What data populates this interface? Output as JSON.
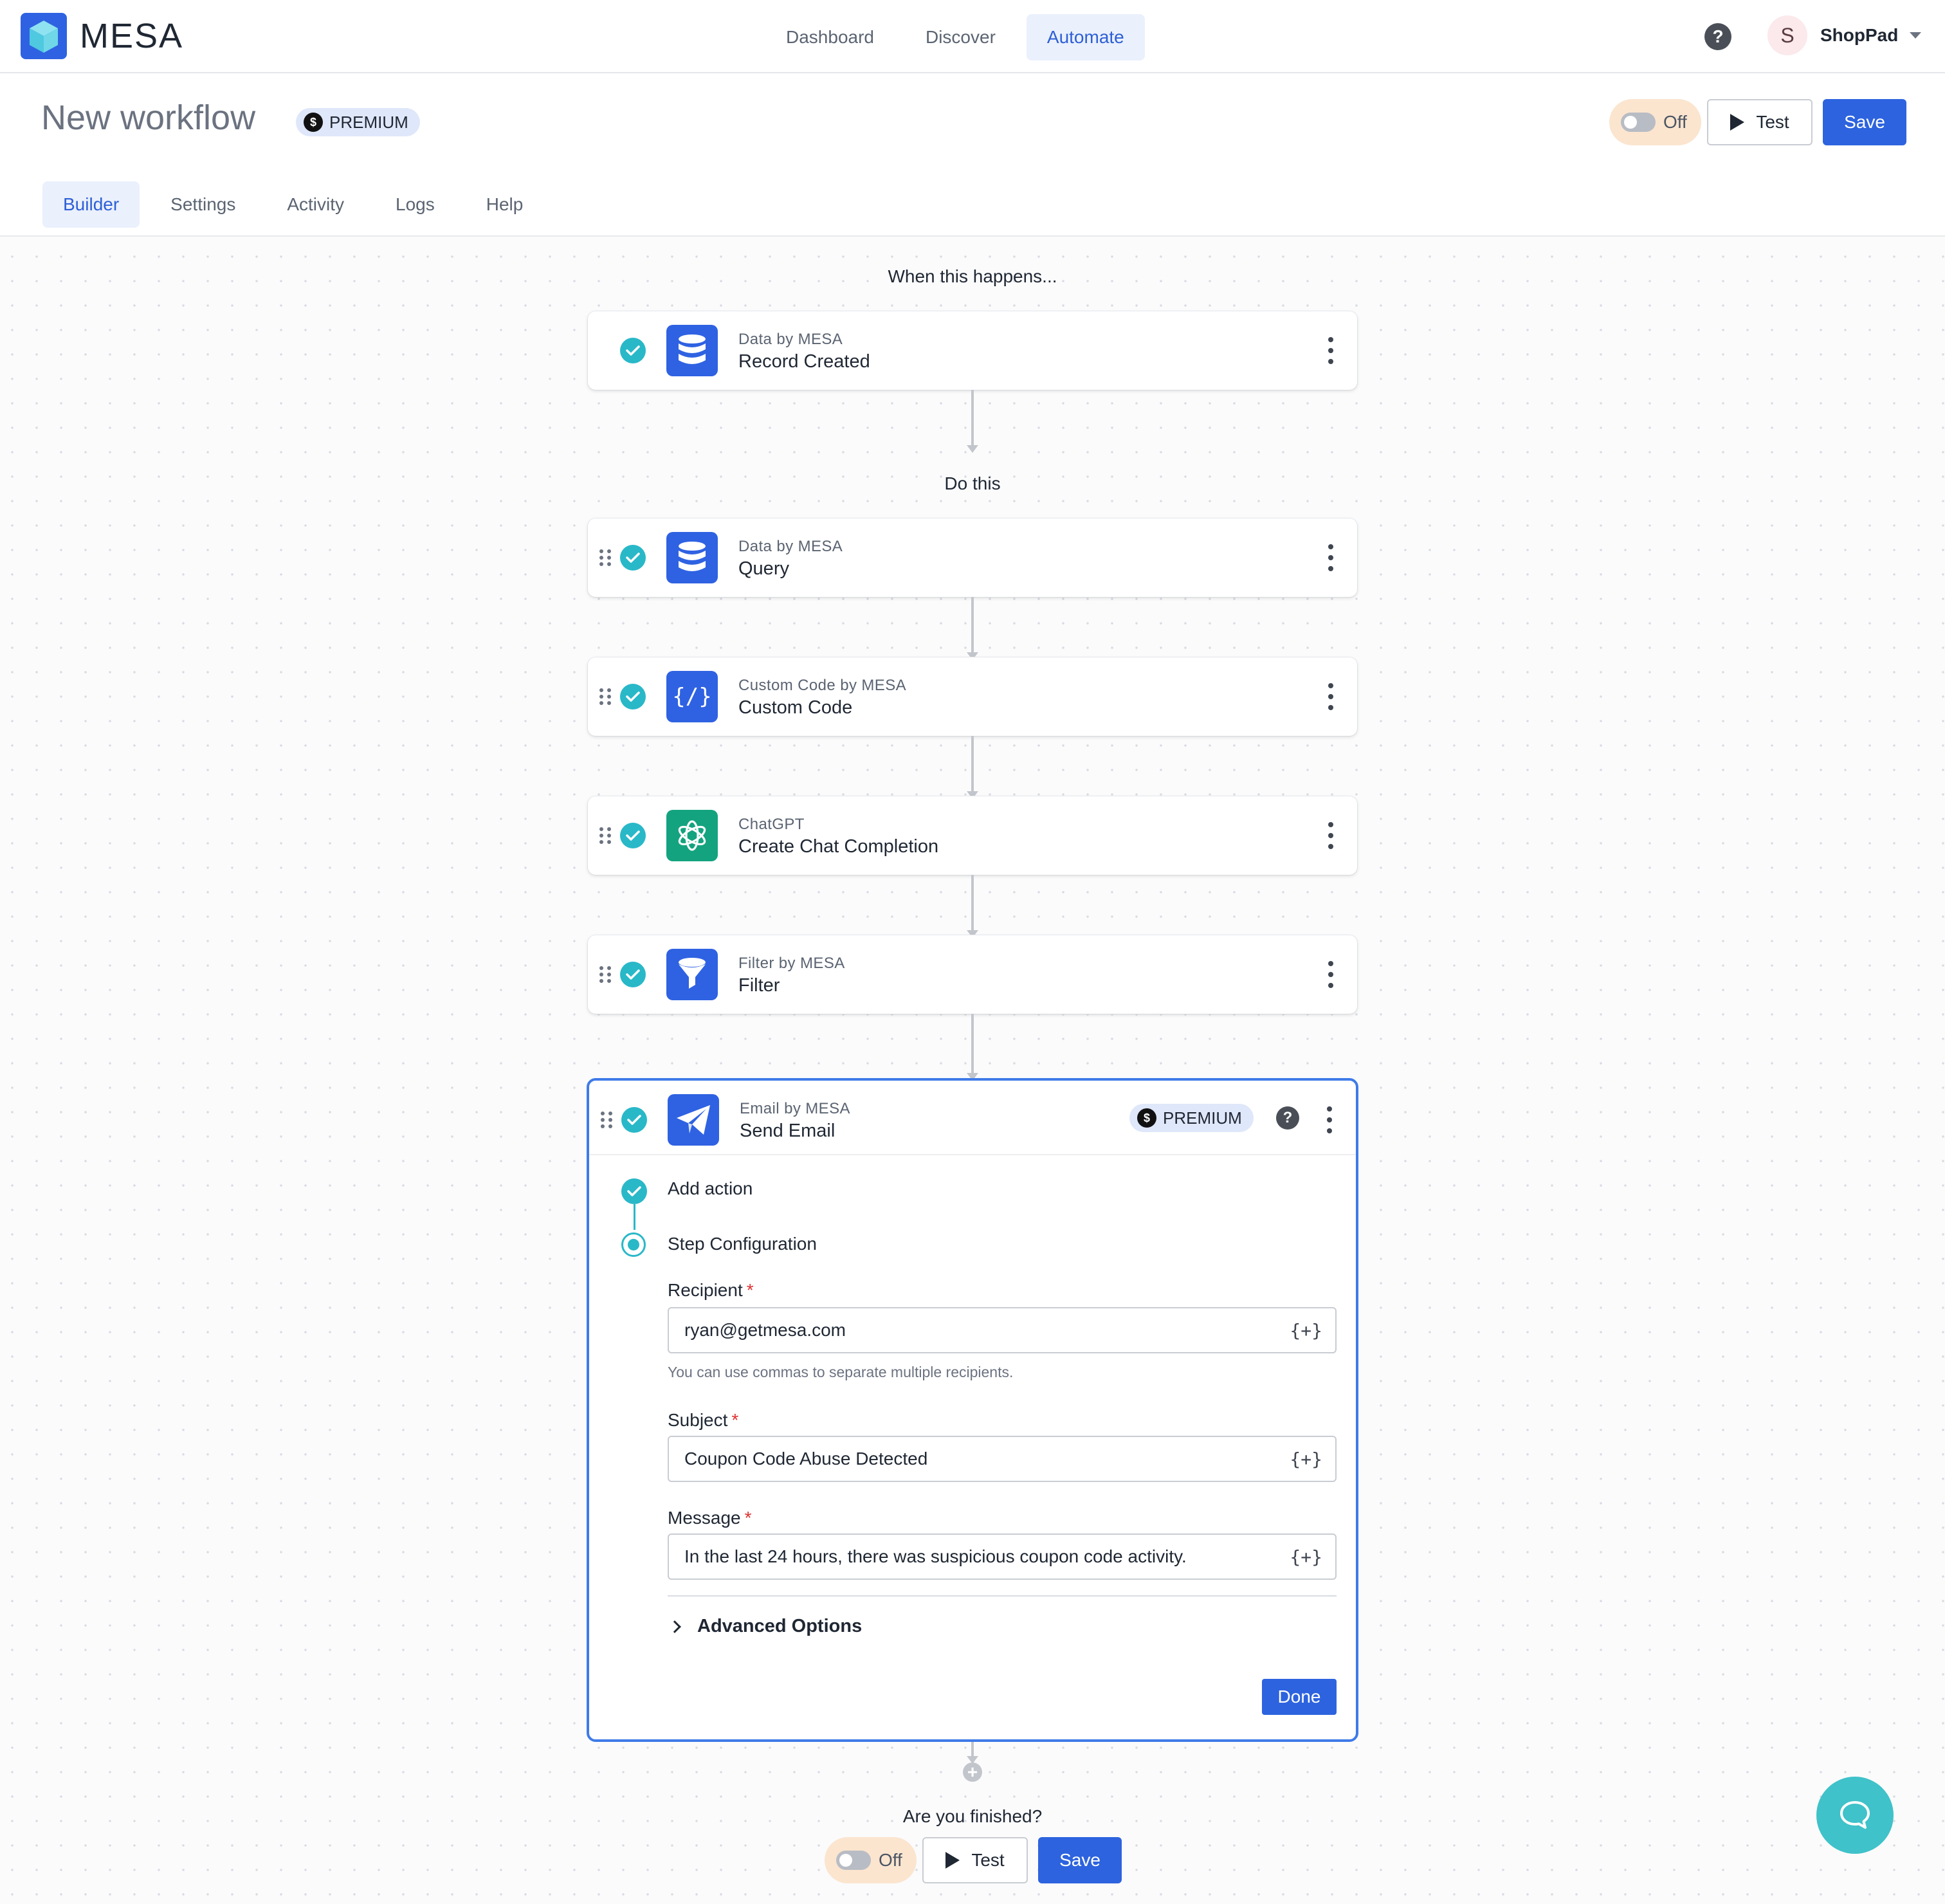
{
  "brand": {
    "name": "MESA"
  },
  "nav": {
    "tabs": [
      {
        "label": "Dashboard"
      },
      {
        "label": "Discover"
      },
      {
        "label": "Automate"
      }
    ],
    "active": "Automate"
  },
  "account": {
    "initial": "S",
    "name": "ShopPad"
  },
  "workflow": {
    "title": "New workflow",
    "badge": "PREMIUM",
    "currency_symbol": "$",
    "toggle_label": "Off",
    "test_label": "Test",
    "save_label": "Save"
  },
  "subtabs": [
    {
      "label": "Builder"
    },
    {
      "label": "Settings"
    },
    {
      "label": "Activity"
    },
    {
      "label": "Logs"
    },
    {
      "label": "Help"
    }
  ],
  "canvas": {
    "trigger_heading": "When this happens...",
    "actions_heading": "Do this",
    "trigger": {
      "app": "Data by MESA",
      "action": "Record Created",
      "icon": "database-icon"
    },
    "steps": [
      {
        "app": "Data by MESA",
        "action": "Query",
        "icon": "database-icon"
      },
      {
        "app": "Custom Code by MESA",
        "action": "Custom Code",
        "icon": "code-icon"
      },
      {
        "app": "ChatGPT",
        "action": "Create Chat Completion",
        "icon": "openai-icon"
      },
      {
        "app": "Filter by MESA",
        "action": "Filter",
        "icon": "funnel-icon"
      }
    ],
    "expanded": {
      "app": "Email by MESA",
      "action": "Send Email",
      "badge": "PREMIUM",
      "currency_symbol": "$",
      "icon": "paper-plane-icon",
      "timeline": [
        {
          "label": "Add action",
          "state": "done"
        },
        {
          "label": "Step Configuration",
          "state": "current"
        }
      ],
      "fields": {
        "recipient": {
          "label": "Recipient",
          "value": "ryan@getmesa.com",
          "hint": "You can use commas to separate multiple recipients."
        },
        "subject": {
          "label": "Subject",
          "value": "Coupon Code Abuse Detected"
        },
        "message": {
          "label": "Message",
          "value": "In the last 24 hours, there was suspicious coupon code activity."
        }
      },
      "required_marker": "*",
      "variable_icon": "{+}",
      "advanced_label": "Advanced Options",
      "done_label": "Done"
    },
    "footer": {
      "question": "Are you finished?",
      "toggle_label": "Off",
      "test_label": "Test",
      "save_label": "Save"
    }
  },
  "colors": {
    "primary": "#2d63de",
    "accent_teal": "#29b8c8",
    "toggle_bg": "#fbe5cf",
    "premium_bg": "#dfe7fa",
    "chatgpt_green": "#14a37f"
  }
}
